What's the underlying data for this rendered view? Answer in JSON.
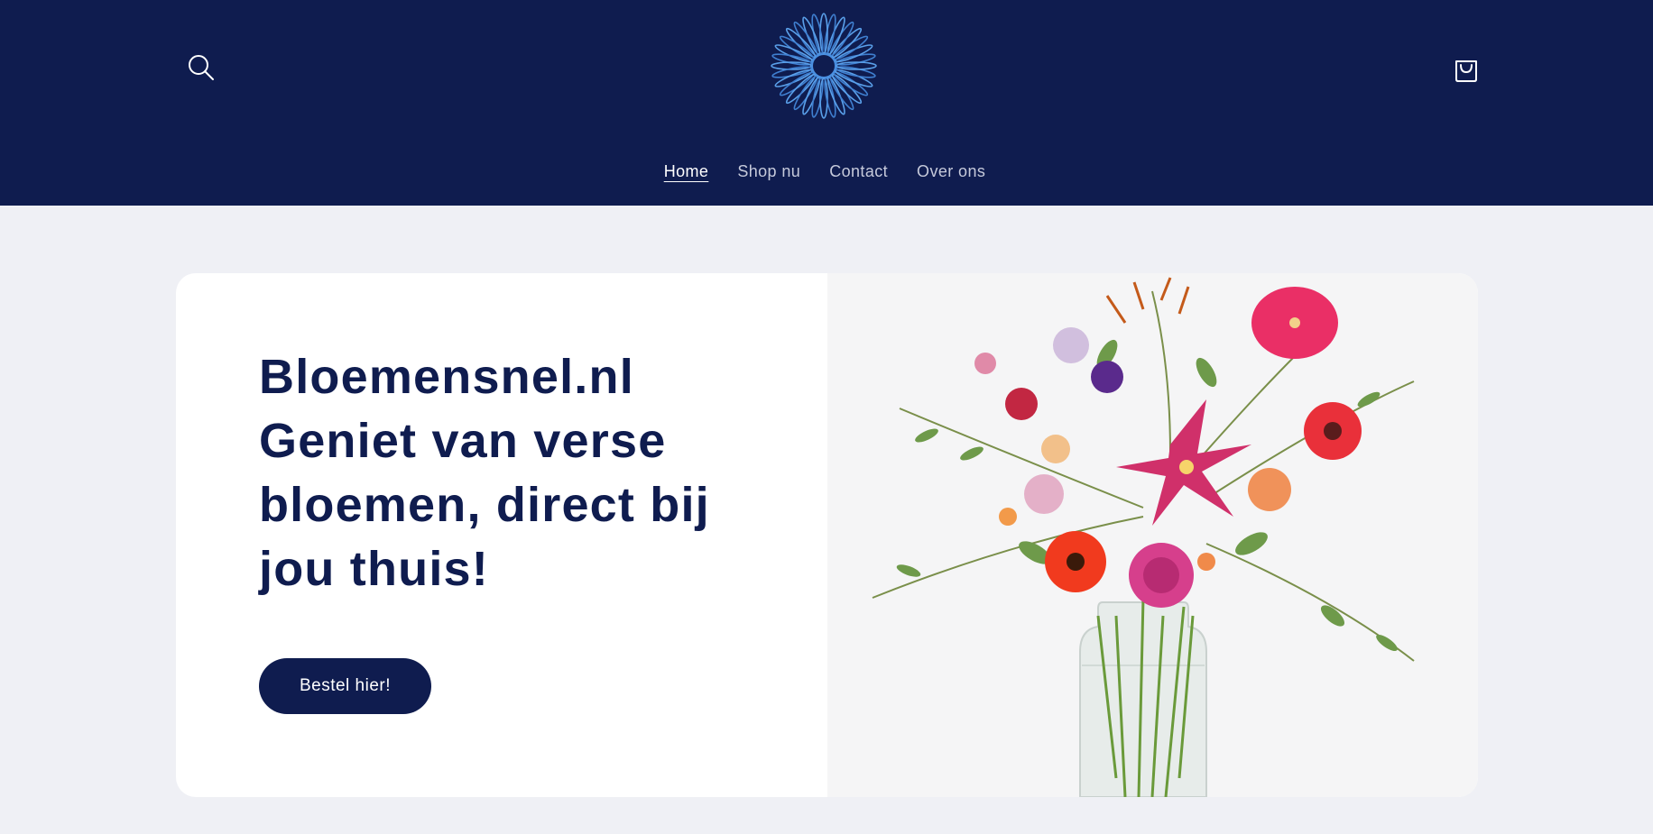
{
  "header": {
    "background": "#0f1c4f",
    "search_icon": "search-icon",
    "cart_icon": "cart-icon",
    "logo_icon": "daisy-flower-logo",
    "nav": [
      {
        "label": "Home",
        "active": true
      },
      {
        "label": "Shop nu",
        "active": false
      },
      {
        "label": "Contact",
        "active": false
      },
      {
        "label": "Over ons",
        "active": false
      }
    ]
  },
  "hero": {
    "heading_line1": "Bloemensnel.nl",
    "heading_line2": "Geniet van verse",
    "heading_line3": "bloemen, direct bij",
    "heading_line4": "jou thuis!",
    "button_label": "Bestel hier!",
    "accent_color": "#0f1c4f"
  },
  "page": {
    "background": "#eff0f5"
  }
}
